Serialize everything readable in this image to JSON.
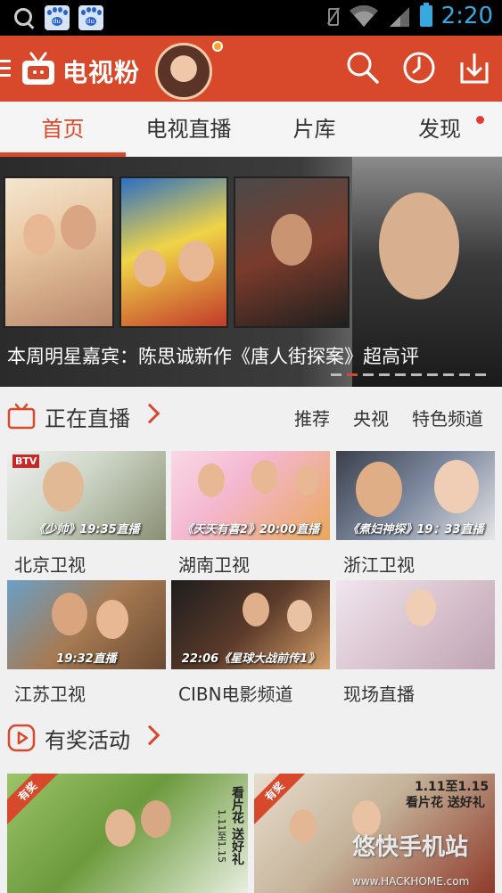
{
  "status_bar": {
    "time": "2:20",
    "icons": [
      "search-icon",
      "baidu-paw-icon",
      "baidu-paw-icon",
      "vibrate-off-icon",
      "wifi-icon",
      "signal-icon",
      "battery-icon"
    ]
  },
  "app_bar": {
    "title": "电视粉",
    "icons": [
      "menu-icon",
      "tv-logo-icon",
      "search-icon",
      "history-clock-icon",
      "download-icon"
    ]
  },
  "tabs": [
    {
      "label": "首页",
      "active": true
    },
    {
      "label": "电视直播",
      "active": false
    },
    {
      "label": "片库",
      "active": false
    },
    {
      "label": "发现",
      "active": false,
      "badge": true
    }
  ],
  "banner": {
    "caption": "本周明星嘉宾：陈思诚新作《唐人街探案》超高评",
    "page_index": 2,
    "page_count": 10
  },
  "live_section": {
    "title": "正在直播",
    "links": [
      "推荐",
      "央视",
      "特色频道"
    ],
    "channels": [
      {
        "name": "北京卫视",
        "overlay": "《少帅》19:35直播",
        "badge": "BTV"
      },
      {
        "name": "湖南卫视",
        "overlay": "《天天有喜2》20:00直播",
        "badge": ""
      },
      {
        "name": "浙江卫视",
        "overlay": "《煮妇神探》19：33直播",
        "badge": ""
      },
      {
        "name": "江苏卫视",
        "overlay": "19:32直播",
        "badge": ""
      },
      {
        "name": "CIBN电影频道",
        "overlay": "22:06《星球大战前传1》",
        "badge": ""
      },
      {
        "name": "现场直播",
        "overlay": "",
        "badge": ""
      }
    ]
  },
  "activity_section": {
    "title": "有奖活动",
    "cards": [
      {
        "ribbon": "有奖",
        "text": "看片花 送好礼",
        "date": "1.11至1.15"
      },
      {
        "ribbon": "有奖",
        "text": "看片花 送好礼",
        "date": "1.11至1.15"
      }
    ]
  },
  "watermark": {
    "text": "悠快手机站",
    "sub": "www.HACKHOME.com"
  },
  "colors": {
    "brand_red": "#d8492c",
    "status_blue": "#36a9e1"
  }
}
